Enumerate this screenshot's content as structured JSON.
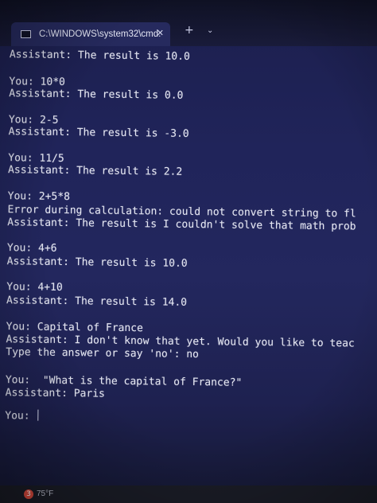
{
  "window": {
    "tab_title": "C:\\WINDOWS\\system32\\cmd.",
    "tab_close_glyph": "✕",
    "new_tab_glyph": "+",
    "dropdown_glyph": "⌄",
    "icon": "terminal-icon"
  },
  "terminal": {
    "lines": [
      "Assistant: The result is 10.0",
      "You: 10*0",
      "Assistant: The result is 0.0",
      "You: 2-5",
      "Assistant: The result is -3.0",
      "You: 11/5",
      "Assistant: The result is 2.2",
      "You: 2+5*8",
      "Error during calculation: could not convert string to fl",
      "Assistant: The result is I couldn't solve that math prob",
      "You: 4+6",
      "Assistant: The result is 10.0",
      "You: 4+10",
      "Assistant: The result is 14.0",
      "You: Capital of France",
      "Assistant: I don't know that yet. Would you like to teac",
      "Type the answer or say 'no': no",
      "You:  \"What is the capital of France?\"",
      "Assistant: Paris",
      "You: "
    ]
  },
  "taskbar": {
    "weather_badge": "3",
    "temperature": "75°F"
  }
}
